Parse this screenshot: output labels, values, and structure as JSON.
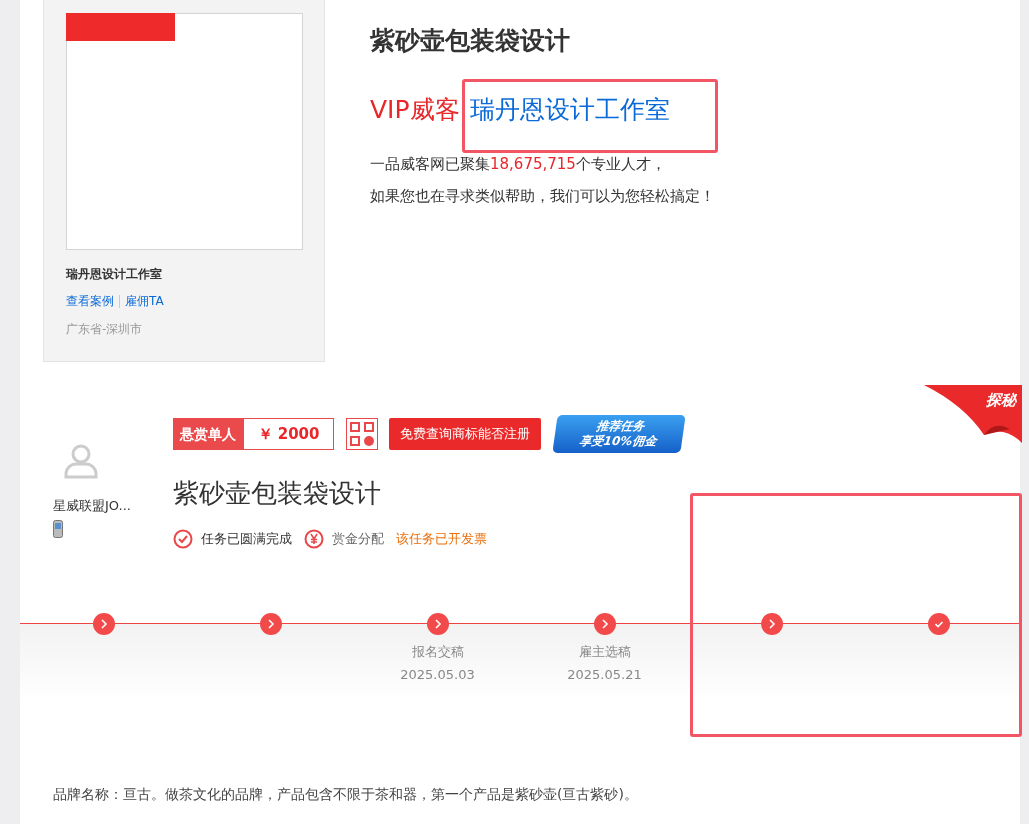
{
  "designer_card": {
    "name": "瑞丹恩设计工作室",
    "links": [
      {
        "label": "查看案例"
      },
      {
        "label": "雇佣TA"
      }
    ],
    "location": "广东省-深圳市"
  },
  "headline": {
    "title": "紫砂壶包装袋设计",
    "vip_prefix": "VIP威客",
    "studio": "瑞丹恩设计工作室",
    "line_1_a": "一品威客网已聚集",
    "talent_count": "18,675,715",
    "line_1_b": "个专业人才，",
    "line_2": "如果您也在寻求类似帮助，我们可以为您轻松搞定！"
  },
  "employer": {
    "name": "星威联盟JO..."
  },
  "task": {
    "mode": "悬赏单人",
    "amount": "￥ 2000",
    "query_button": "免费查询商标能否注册",
    "promo": [
      "推荐任务",
      "享受10%佣金"
    ],
    "title": "紫砂壶包装袋设计",
    "statuses": [
      {
        "kind": "check",
        "label": "任务已圆满完成"
      },
      {
        "kind": "yen",
        "label": "赏金分配"
      },
      {
        "kind": "note",
        "label": "该任务已开发票"
      }
    ]
  },
  "corner_ribbon": "探秘",
  "timeline": [
    {
      "kind": "next"
    },
    {
      "kind": "next"
    },
    {
      "kind": "next",
      "label": "报名交稿",
      "date": "2025.05.03"
    },
    {
      "kind": "next",
      "label": "雇主选稿",
      "date": "2025.05.21"
    },
    {
      "kind": "next"
    },
    {
      "kind": "done"
    }
  ],
  "description": "品牌名称：亘古。做茶文化的品牌，产品包含不限于茶和器，第一个产品是紫砂壶(亘古紫砂)。"
}
